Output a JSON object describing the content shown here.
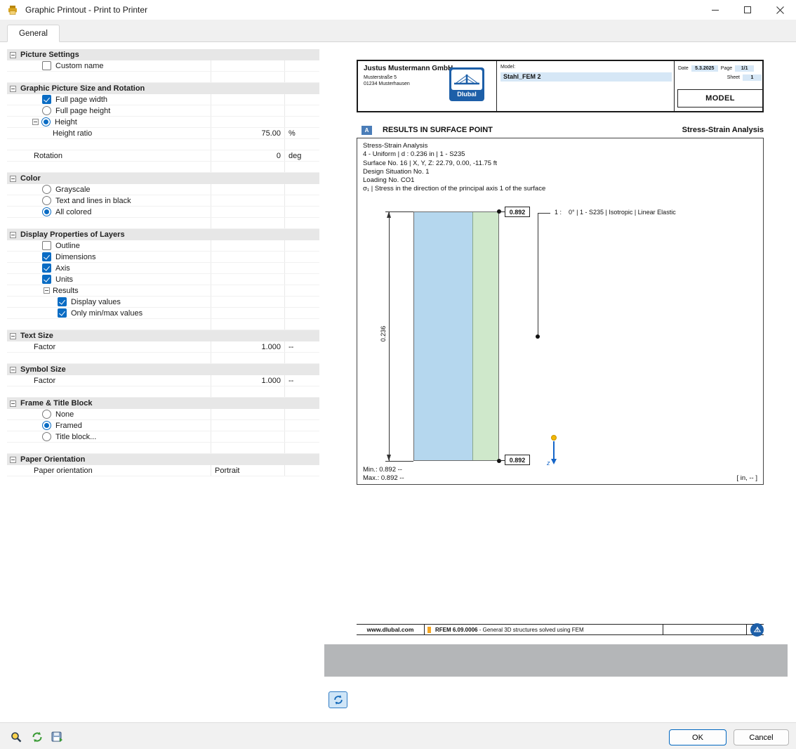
{
  "window": {
    "title": "Graphic Printout - Print to Printer"
  },
  "tab": {
    "general": "General"
  },
  "panel": {
    "picture_settings": {
      "title": "Picture Settings",
      "custom_name": "Custom name"
    },
    "size_rotation": {
      "title": "Graphic Picture Size and Rotation",
      "full_page_width": "Full page width",
      "full_page_height": "Full page height",
      "height": "Height",
      "height_ratio": "Height ratio",
      "height_ratio_value": "75.00",
      "height_ratio_unit": "%",
      "rotation": "Rotation",
      "rotation_value": "0",
      "rotation_unit": "deg"
    },
    "color": {
      "title": "Color",
      "grayscale": "Grayscale",
      "black": "Text and lines in black",
      "all_colored": "All colored"
    },
    "layers": {
      "title": "Display Properties of Layers",
      "outline": "Outline",
      "dimensions": "Dimensions",
      "axis": "Axis",
      "units": "Units",
      "results": "Results",
      "display_values": "Display values",
      "only_minmax": "Only min/max values"
    },
    "text_size": {
      "title": "Text Size",
      "factor": "Factor",
      "value": "1.000",
      "unit": "--"
    },
    "symbol_size": {
      "title": "Symbol Size",
      "factor": "Factor",
      "value": "1.000",
      "unit": "--"
    },
    "frame": {
      "title": "Frame & Title Block",
      "none": "None",
      "framed": "Framed",
      "title_block": "Title block..."
    },
    "orientation": {
      "title": "Paper Orientation",
      "label": "Paper orientation",
      "value": "Portrait"
    }
  },
  "preview": {
    "header": {
      "company": "Justus Mustermann GmbH",
      "address1": "Musterstraße 5",
      "address2": "01234 Musterhausen",
      "logo_text": "Dlubal",
      "model_label": "Model:",
      "model_value": "Stahl_FEM 2",
      "date_label": "Date",
      "date_value": "5.3.2025",
      "page_label": "Page",
      "page_value": "1/1",
      "sheet_label": "Sheet",
      "sheet_value": "1",
      "model_box": "MODEL"
    },
    "section": {
      "badge": "A",
      "title": "RESULTS IN SURFACE POINT",
      "subtitle": "Stress-Strain Analysis"
    },
    "info_lines": [
      "Stress-Strain Analysis",
      "4 - Uniform | d : 0.236 in | 1 - S235",
      "Surface No. 16 | X, Y, Z: 22.79, 0.00, -11.75 ft",
      "Design Situation No. 1",
      "Loading No. CO1",
      "σ₁ | Stress in the direction of the principal axis 1 of the surface"
    ],
    "figure": {
      "thickness_dim": "0.236",
      "top_value": "0.892",
      "bottom_value": "0.892",
      "material_note": "1 :    0° | 1 - S235 | Isotropic | Linear Elastic",
      "z_label": "z"
    },
    "min_label": "Min.: 0.892 --",
    "max_label": "Max.: 0.892 --",
    "units_note": "[ in, -- ]",
    "footer": {
      "website": "www.dlubal.com",
      "program": "RFEM 6.09.0006",
      "program_desc": " - General 3D structures solved using FEM",
      "logo_text": "Dlubal"
    }
  },
  "actions": {
    "ok": "OK",
    "cancel": "Cancel"
  }
}
